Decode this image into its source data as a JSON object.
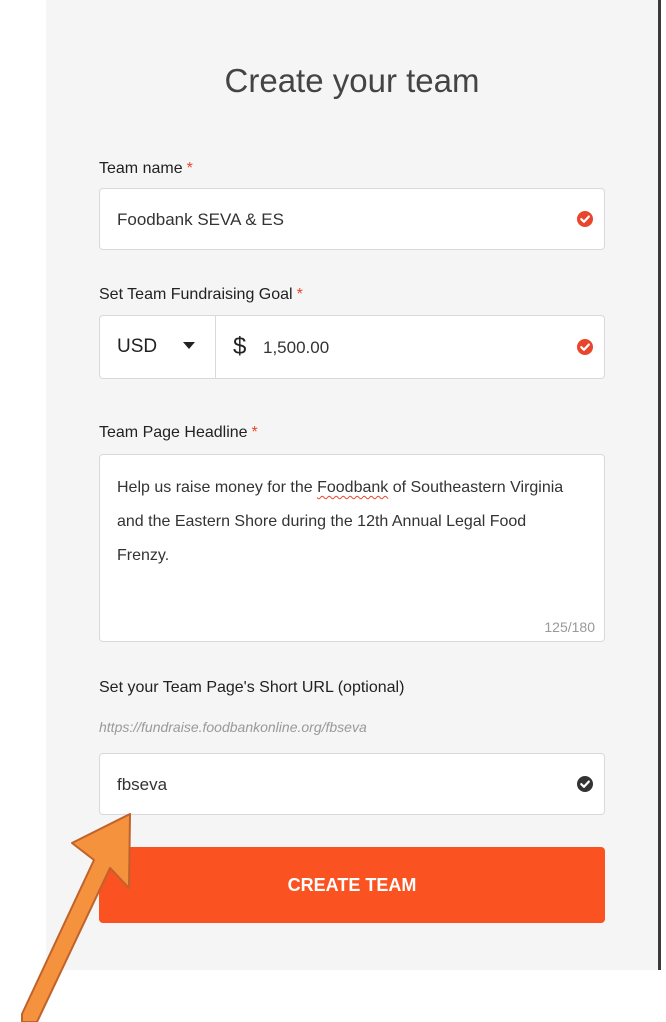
{
  "form": {
    "title": "Create your team",
    "team_name": {
      "label": "Team name",
      "required_mark": "*",
      "value": "Foodbank SEVA & ES"
    },
    "goal": {
      "label": "Set Team Fundraising Goal",
      "required_mark": "*",
      "currency": "USD",
      "currency_symbol": "$",
      "amount": "1,500.00"
    },
    "headline": {
      "label": "Team Page Headline",
      "required_mark": "*",
      "text_before": "Help us raise money for the ",
      "misspelled_word": "Foodbank",
      "text_after": " of Southeastern Virginia and the Eastern Shore during the 12th Annual Legal Food Frenzy.",
      "counter": "125/180"
    },
    "short_url": {
      "label": "Set your Team Page's Short URL (optional)",
      "hint": "https://fundraise.foodbankonline.org/fbseva",
      "value": "fbseva"
    },
    "submit_label": "CREATE TEAM"
  },
  "colors": {
    "accent": "#fa5220",
    "valid_check": "#e8452c",
    "neutral_check": "#333333",
    "annotation_arrow": "#f5923e"
  },
  "icons": {
    "valid": "check-circle-icon",
    "dropdown": "caret-down-icon",
    "annotation": "arrow-pointer-icon"
  }
}
